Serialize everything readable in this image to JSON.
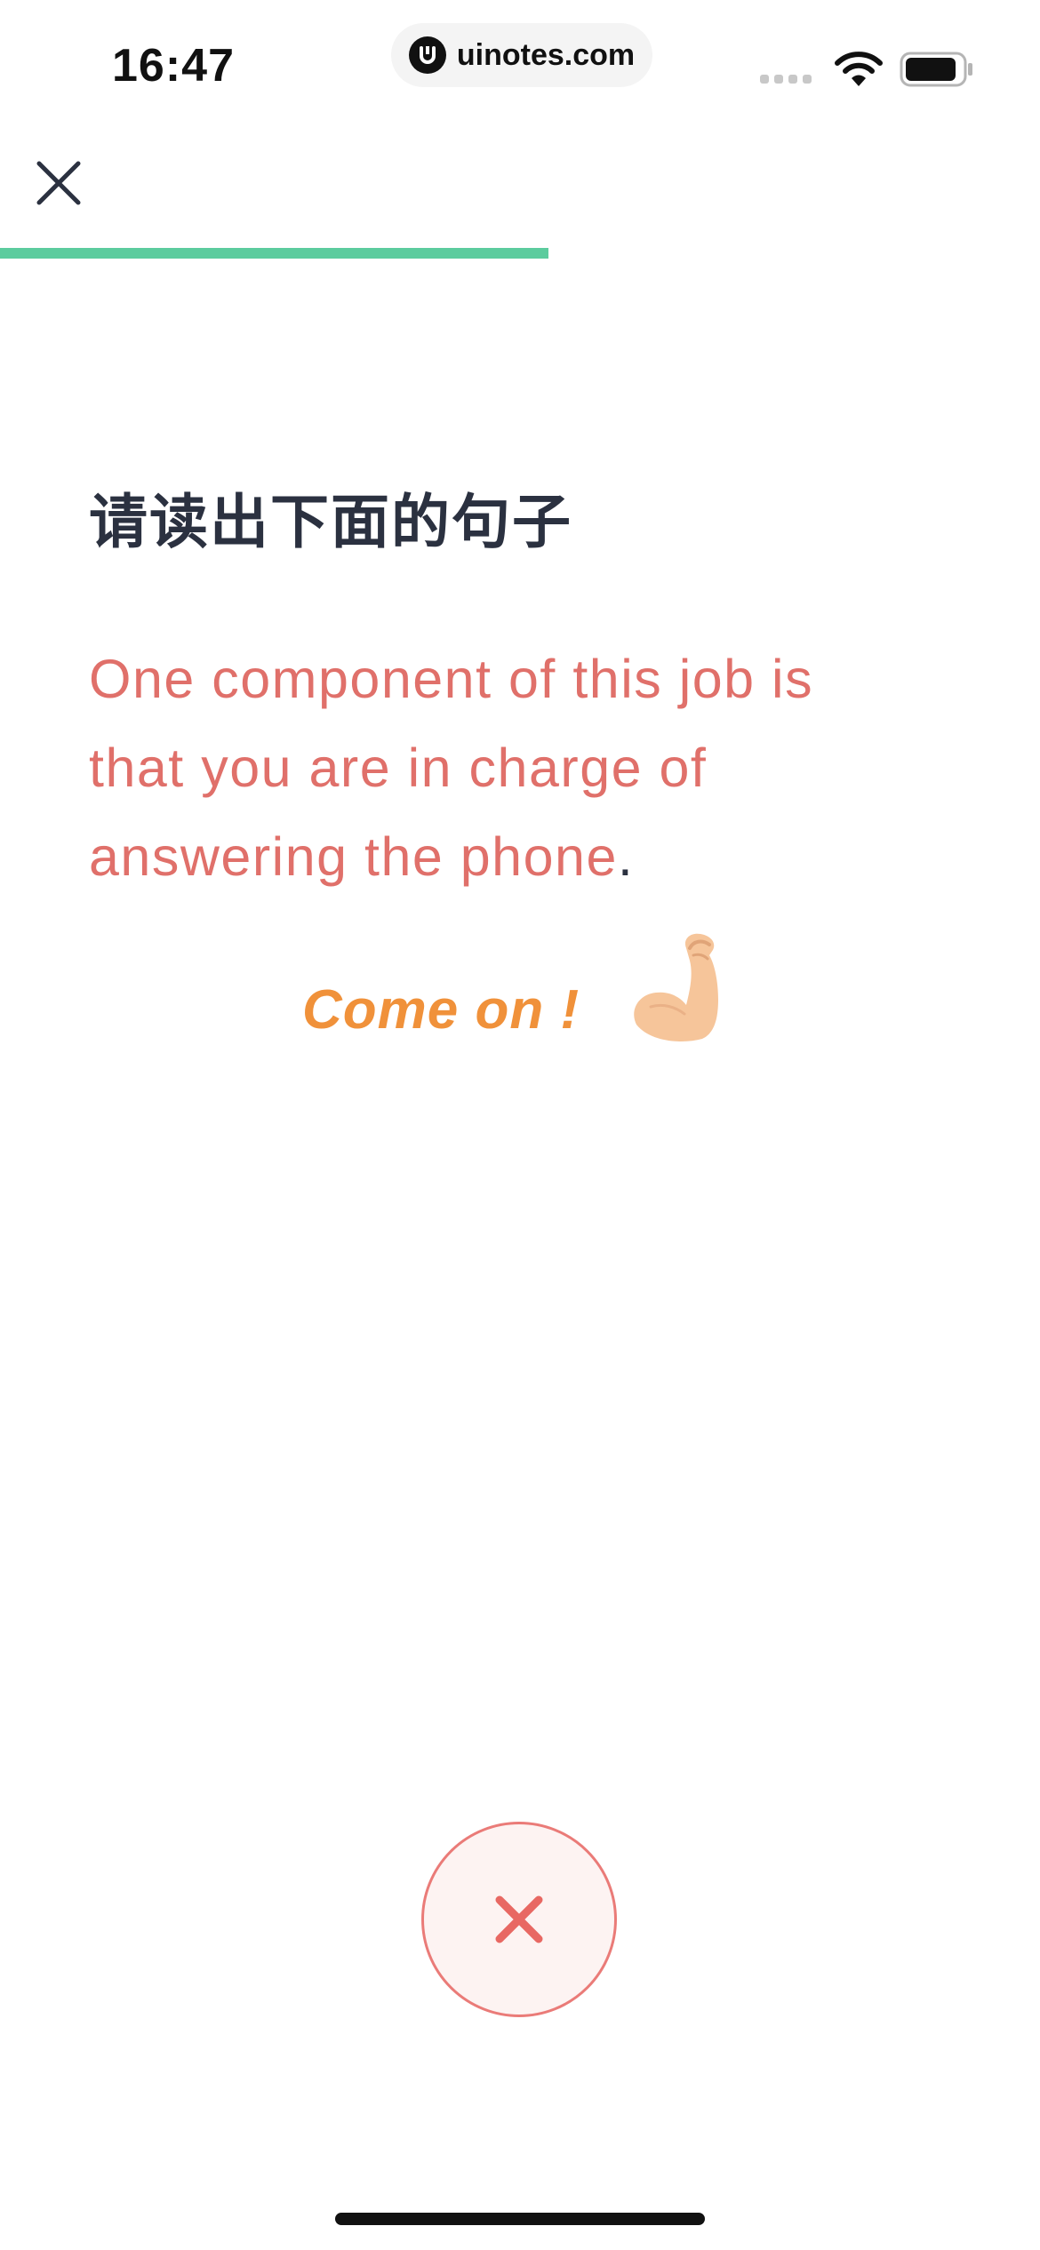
{
  "status_bar": {
    "time": "16:47",
    "watermark": "uinotes.com"
  },
  "progress": {
    "fraction": 0.527,
    "color": "#5ccc9e"
  },
  "header": {
    "close_icon": "close-icon"
  },
  "prompt": {
    "instruction": "请读出下面的句子",
    "sentence": "One component of this job is that you are in charge of answering the phone",
    "sentence_end": "."
  },
  "encouragement": {
    "text": "Come on !",
    "icon": "flexed-biceps-icon"
  },
  "controls": {
    "stop_icon": "stop-x-icon",
    "accent_color": "#ea7b78"
  }
}
